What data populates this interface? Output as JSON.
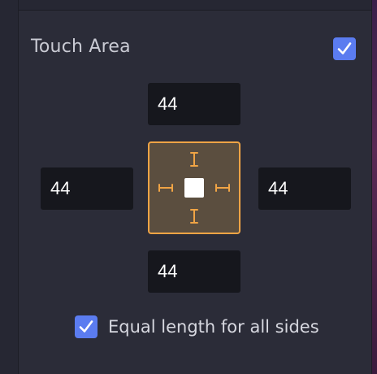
{
  "section": {
    "title": "Touch Area",
    "enabled": true
  },
  "padding": {
    "top": "44",
    "left": "44",
    "right": "44",
    "bottom": "44"
  },
  "equal_sides": {
    "label": "Equal length for all sides",
    "checked": true
  },
  "colors": {
    "checkbox": "#5b7cf0",
    "accent": "#f0a445",
    "field_bg": "#16171d",
    "panel_bg": "#2b2c38"
  },
  "icons": {
    "checkbox": "checkmark-icon",
    "area_handles": "resize-handle-icon",
    "target": "touch-target-icon"
  }
}
